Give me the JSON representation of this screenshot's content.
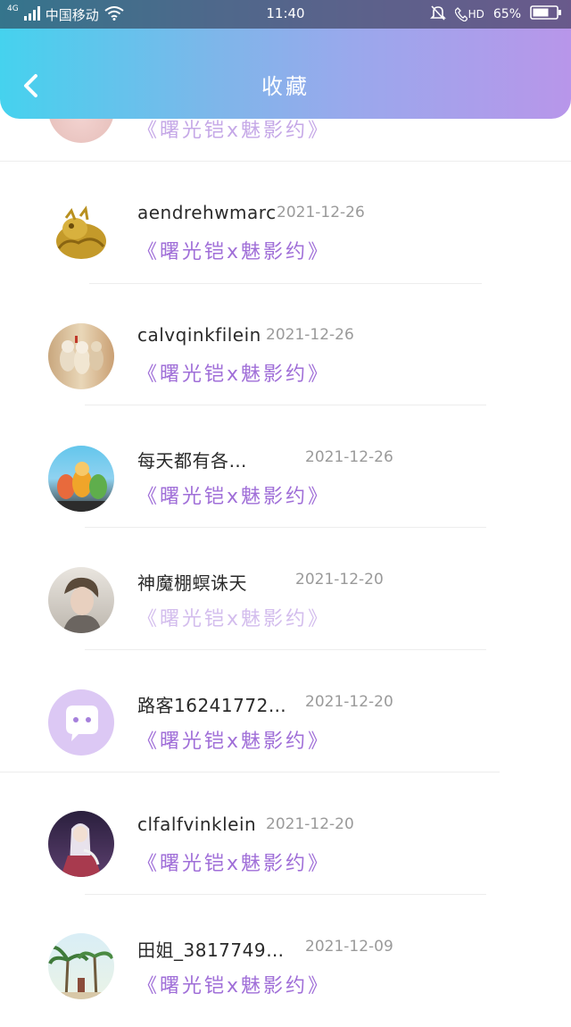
{
  "status_bar": {
    "network": "4G",
    "carrier": "中国移动",
    "time": "11:40",
    "hd": "HD",
    "battery": "65%"
  },
  "header": {
    "title": "收藏",
    "colors": {
      "gradient_start": "#45d2ee",
      "gradient_end": "#b896ea"
    }
  },
  "favorites": [
    {
      "username": "aendrehwmarc",
      "date": "2021-12-26",
      "work_title": "《曙光铠x魅影约》"
    },
    {
      "username": "calvqinkfilein",
      "date": "2021-12-26",
      "work_title": "《曙光铠x魅影约》"
    },
    {
      "username": "每天都有各…",
      "date": "2021-12-26",
      "work_title": "《曙光铠x魅影约》"
    },
    {
      "username": "神魔棚螟诛天",
      "date": "2021-12-20",
      "work_title": "《曙光铠x魅影约》"
    },
    {
      "username": "路客16241772…",
      "date": "2021-12-20",
      "work_title": "《曙光铠x魅影约》"
    },
    {
      "username": "clfalfvinklein",
      "date": "2021-12-20",
      "work_title": "《曙光铠x魅影约》"
    },
    {
      "username": "田姐_3817749…",
      "date": "2021-12-09",
      "work_title": "《曙光铠x魅影约》"
    }
  ],
  "partial_top_row": {
    "work_title": "《曙光铠x魅影约》"
  },
  "colors": {
    "accent": "#a06fd8",
    "date": "#9a9a9a"
  }
}
